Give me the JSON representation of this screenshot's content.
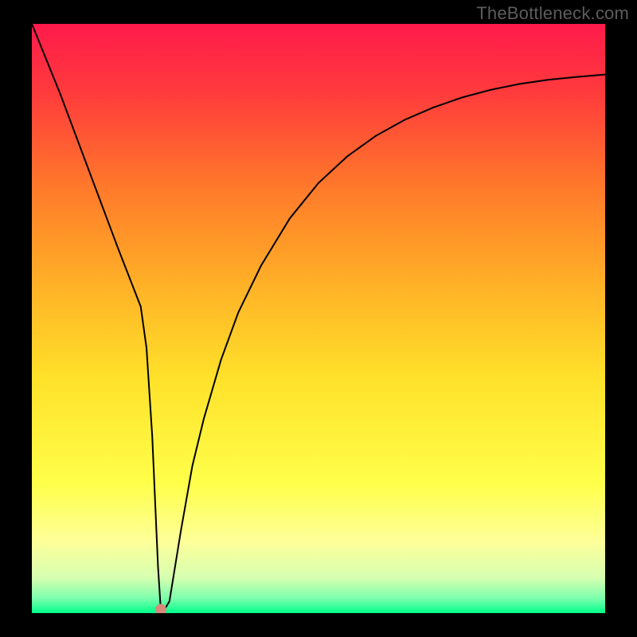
{
  "attribution": "TheBottleneck.com",
  "chart_data": {
    "type": "line",
    "title": "",
    "xlabel": "",
    "ylabel": "",
    "xlim": [
      0,
      100
    ],
    "ylim": [
      0,
      100
    ],
    "grid": false,
    "legend": false,
    "background_gradient": {
      "stops": [
        {
          "pos": 0.0,
          "color": "#ff1a4b"
        },
        {
          "pos": 0.12,
          "color": "#ff3c3c"
        },
        {
          "pos": 0.28,
          "color": "#ff7a2a"
        },
        {
          "pos": 0.45,
          "color": "#ffb327"
        },
        {
          "pos": 0.6,
          "color": "#ffe12a"
        },
        {
          "pos": 0.78,
          "color": "#ffff4a"
        },
        {
          "pos": 0.88,
          "color": "#fdff9a"
        },
        {
          "pos": 0.94,
          "color": "#d6ffb0"
        },
        {
          "pos": 0.975,
          "color": "#7cffad"
        },
        {
          "pos": 1.0,
          "color": "#00ff8a"
        }
      ]
    },
    "marker": {
      "x": 22.5,
      "y": 0.6,
      "color": "#d88a7a",
      "r": 7
    },
    "series": [
      {
        "name": "curve",
        "color": "#000000",
        "width": 2.0,
        "x": [
          0,
          5,
          10,
          15,
          19,
          20,
          21,
          22,
          22.5,
          23,
          24,
          26,
          28,
          30,
          33,
          36,
          40,
          45,
          50,
          55,
          60,
          65,
          70,
          75,
          80,
          85,
          90,
          95,
          100
        ],
        "y": [
          100,
          88,
          75,
          62,
          52,
          45,
          30,
          8,
          0.4,
          0.4,
          2,
          14,
          25,
          33,
          43,
          51,
          59,
          67,
          73,
          77.5,
          81,
          83.7,
          85.8,
          87.5,
          88.8,
          89.8,
          90.5,
          91,
          91.4
        ]
      }
    ]
  }
}
